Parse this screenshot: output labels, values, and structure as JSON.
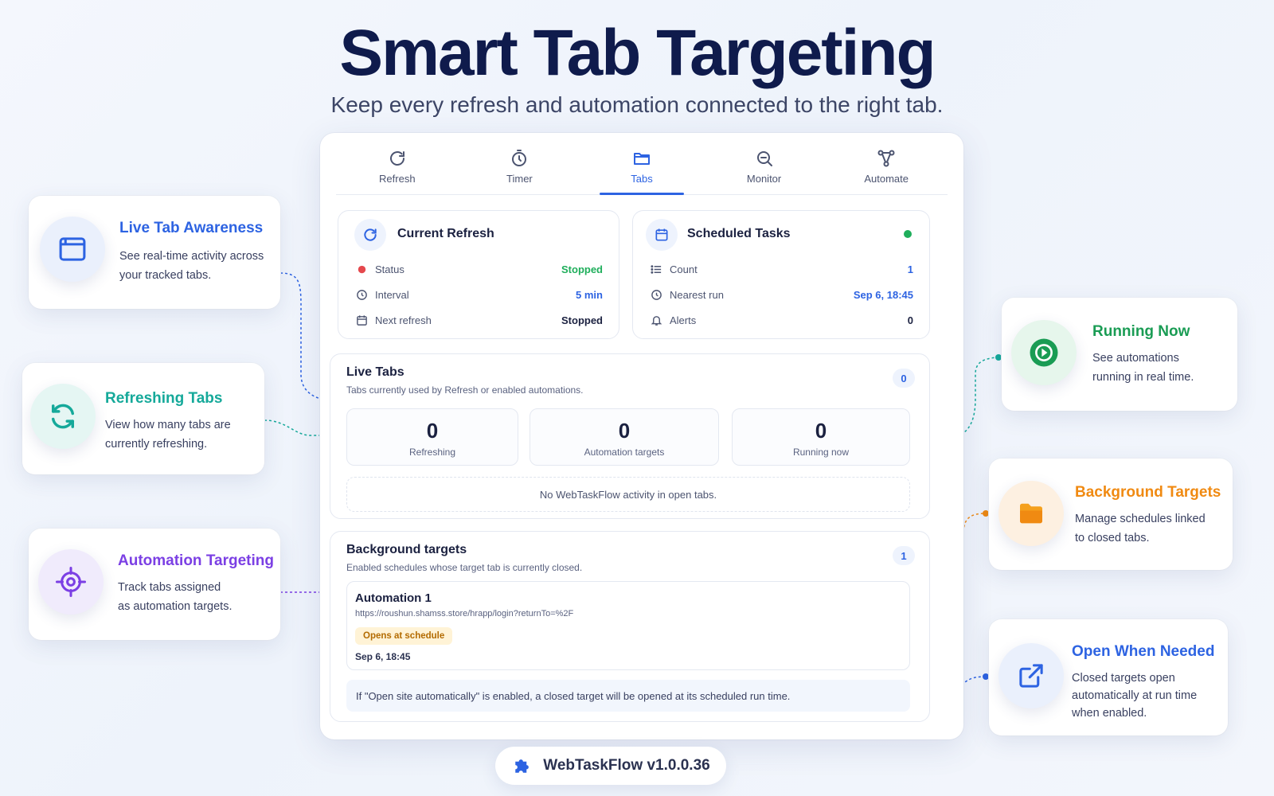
{
  "hero": {
    "title": "Smart Tab Targeting",
    "subtitle": "Keep every refresh and automation connected to the right tab."
  },
  "tabs": [
    {
      "label": "Refresh",
      "icon": "refresh-icon"
    },
    {
      "label": "Timer",
      "icon": "stopwatch-icon"
    },
    {
      "label": "Tabs",
      "icon": "folder-icon",
      "active": true
    },
    {
      "label": "Monitor",
      "icon": "magnifier-icon"
    },
    {
      "label": "Automate",
      "icon": "flow-icon"
    }
  ],
  "current_refresh": {
    "title": "Current Refresh",
    "rows": [
      {
        "label": "Status",
        "value": "Stopped"
      },
      {
        "label": "Interval",
        "value": "5 min"
      },
      {
        "label": "Next refresh",
        "value": "Stopped"
      }
    ]
  },
  "scheduled_tasks": {
    "title": "Scheduled Tasks",
    "rows": [
      {
        "label": "Count",
        "value": "1"
      },
      {
        "label": "Nearest run",
        "value": "Sep 6, 18:45"
      },
      {
        "label": "Alerts",
        "value": "0"
      }
    ]
  },
  "live_tabs": {
    "title": "Live Tabs",
    "subtitle": "Tabs currently used by Refresh or enabled automations.",
    "count": "0",
    "stats": [
      {
        "value": "0",
        "label": "Refreshing"
      },
      {
        "value": "0",
        "label": "Automation targets"
      },
      {
        "value": "0",
        "label": "Running now"
      }
    ],
    "empty_text": "No WebTaskFlow activity in open tabs."
  },
  "background_targets": {
    "title": "Background targets",
    "subtitle": "Enabled schedules whose target tab is currently closed.",
    "count": "1",
    "item": {
      "name": "Automation 1",
      "url": "https://roushun.shamss.store/hrapp/login?returnTo=%2F",
      "tag": "Opens at schedule",
      "time": "Sep 6, 18:45"
    },
    "note": "If \"Open site automatically\" is enabled, a closed target will be opened at its scheduled run time."
  },
  "features_left": [
    {
      "title": "Live Tab Awareness",
      "desc1": "See real-time activity across",
      "desc2": "your tracked tabs.",
      "icon": "browser-window-icon",
      "color": "#2d63e2"
    },
    {
      "title": "Refreshing Tabs",
      "desc1": "View how many tabs are",
      "desc2": "currently refreshing.",
      "icon": "sync-icon",
      "color": "#15a99a"
    },
    {
      "title": "Automation Targeting",
      "desc1": "Track tabs assigned",
      "desc2": "as automation targets.",
      "icon": "crosshair-icon",
      "color": "#7b3fe4"
    }
  ],
  "features_right": [
    {
      "title": "Running Now",
      "desc1": "See automations",
      "desc2": "running in real time.",
      "desc3": "",
      "icon": "play-icon",
      "color": "#1a9c54"
    },
    {
      "title": "Background Targets",
      "desc1": "Manage schedules linked",
      "desc2": "to closed tabs.",
      "desc3": "",
      "icon": "folder-icon",
      "color": "#f08a12"
    },
    {
      "title": "Open When Needed",
      "desc1": "Closed targets open",
      "desc2": "automatically at run time",
      "desc3": "when enabled.",
      "icon": "external-link-icon",
      "color": "#2d63e2"
    }
  ],
  "colors": {
    "accent": "#2d63e2",
    "status_red": "#e5484d",
    "success_green": "#1fae5b",
    "tag_bg": "#fff3d6",
    "tag_text": "#b36b00"
  },
  "footer": {
    "label": "WebTaskFlow v1.0.0.36",
    "icon": "puzzle-icon"
  }
}
